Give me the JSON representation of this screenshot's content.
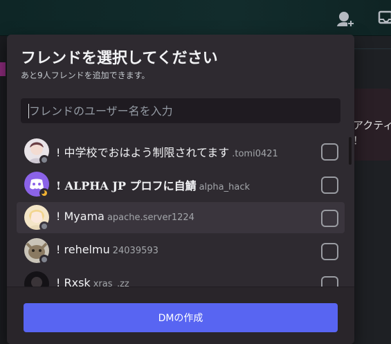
{
  "dialog": {
    "title": "フレンドを選択してください",
    "subtitle": "あと9人フレンドを追加できます。",
    "search_placeholder": "フレンドのユーザー名を入力",
    "create_dm_label": "DMの作成"
  },
  "friends": [
    {
      "display_name": "! 中学校でおはよう制限されてます",
      "username": ".tomi0421",
      "status": "offline",
      "checked": false,
      "hovered": false
    },
    {
      "display_name": "! ALPHA JP プロフに自鯖",
      "username": "alpha_hack",
      "status": "idle",
      "checked": false,
      "hovered": false
    },
    {
      "display_name": "! Myama",
      "username": "apache.server1224",
      "status": "offline",
      "checked": false,
      "hovered": true
    },
    {
      "display_name": "! rehelmu",
      "username": "24039593",
      "status": "offline",
      "checked": false,
      "hovered": false
    },
    {
      "display_name": "! Rxsk",
      "username": "xras_.zz",
      "status": "offline",
      "checked": false,
      "hovered": false
    }
  ],
  "background": {
    "right_card_text_line1": "アクティ",
    "right_card_text_line2": "！"
  },
  "colors": {
    "accent": "#5865f2",
    "idle": "#f0b232",
    "offline": "#80848e"
  },
  "icons": [
    "add-friend-icon",
    "inbox-icon",
    "idle-moon-icon",
    "discord-logo-icon"
  ]
}
